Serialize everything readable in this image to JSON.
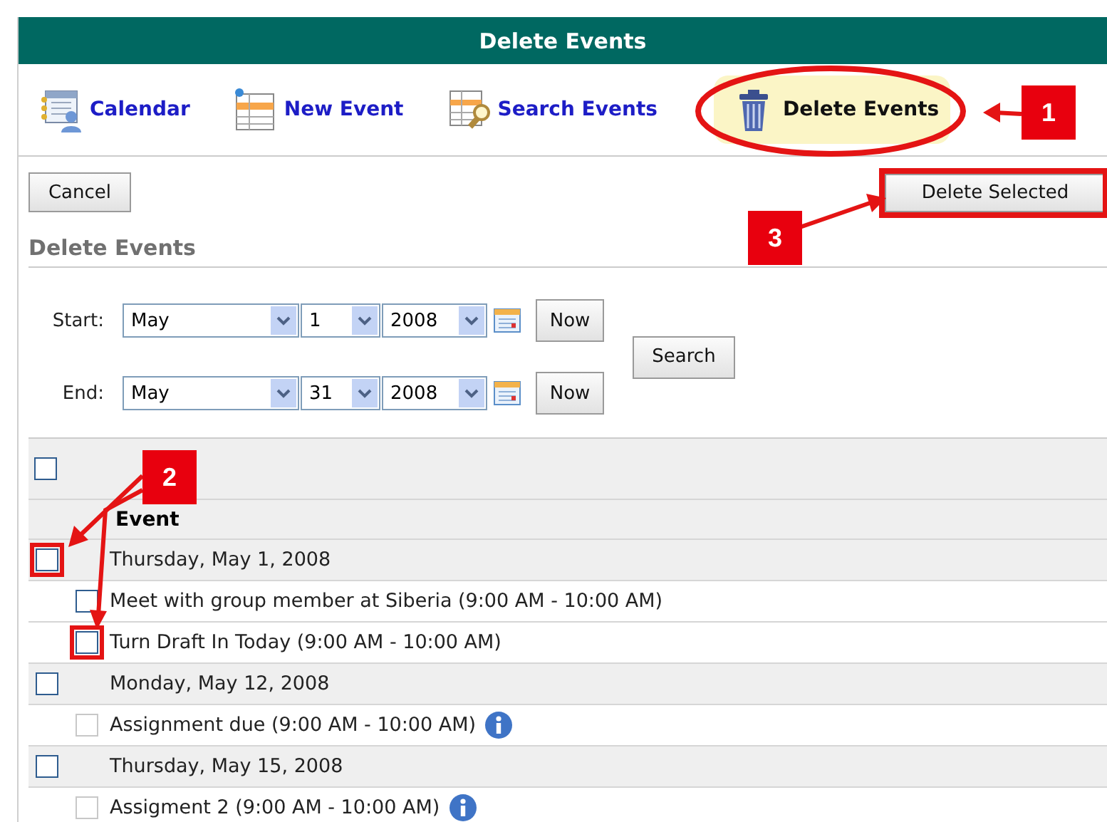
{
  "header": {
    "title": "Delete Events"
  },
  "toolbar": [
    {
      "label": "Calendar",
      "selected": false
    },
    {
      "label": "New Event",
      "selected": false
    },
    {
      "label": "Search Events",
      "selected": false
    },
    {
      "label": "Delete Events",
      "selected": true
    }
  ],
  "cancel_button": "Cancel",
  "delete_button": "Delete Selected",
  "section_title": "Delete Events",
  "filters": [
    {
      "label": "Start:",
      "month": "May",
      "day": "1",
      "year": "2008",
      "now": "Now"
    },
    {
      "label": "End:",
      "month": "May",
      "day": "31",
      "year": "2008",
      "now": "Now"
    }
  ],
  "search_button": "Search",
  "table": {
    "select_all": {
      "checked": false
    },
    "column": "Event",
    "rows": [
      {
        "kind": "date",
        "text": "Thursday, May 1, 2008",
        "checked": false,
        "disabled": false,
        "highlighted": true
      },
      {
        "kind": "event",
        "text": "Meet with group member at Siberia (9:00 AM - 10:00 AM)",
        "checked": false,
        "disabled": false,
        "highlighted": false
      },
      {
        "kind": "event",
        "text": "Turn Draft In Today (9:00 AM - 10:00 AM)",
        "checked": false,
        "disabled": false,
        "highlighted": true
      },
      {
        "kind": "date",
        "text": "Monday, May 12, 2008",
        "checked": false,
        "disabled": false,
        "highlighted": false
      },
      {
        "kind": "event",
        "text": "Assignment due (9:00 AM - 10:00 AM)",
        "checked": false,
        "disabled": true,
        "highlighted": false,
        "info": true
      },
      {
        "kind": "date",
        "text": "Thursday, May 15, 2008",
        "checked": false,
        "disabled": false,
        "highlighted": false
      },
      {
        "kind": "event",
        "text": "Assigment 2 (9:00 AM - 10:00 AM)",
        "checked": false,
        "disabled": true,
        "highlighted": false,
        "info": true
      }
    ]
  },
  "callouts": [
    {
      "number": "1"
    },
    {
      "number": "2"
    },
    {
      "number": "3"
    }
  ]
}
